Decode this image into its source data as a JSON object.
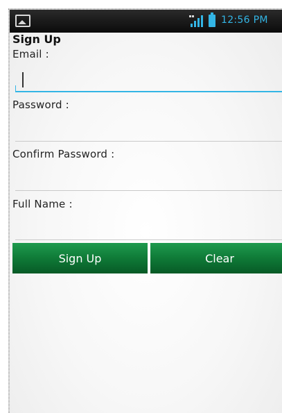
{
  "status_bar": {
    "time": "12:56 PM",
    "icons": [
      "photo-icon",
      "signal-icon",
      "battery-icon"
    ],
    "accent_color": "#33b5e5"
  },
  "form": {
    "title": "Sign Up",
    "email_label": "Email :",
    "password_label": "Password :",
    "confirm_password_label": "Confirm Password :",
    "full_name_label": "Full Name :"
  },
  "buttons": {
    "signup_label": "Sign Up",
    "clear_label": "Clear",
    "color": "#0f7a37"
  }
}
